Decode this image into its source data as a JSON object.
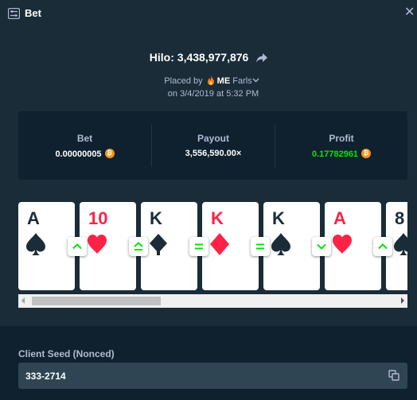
{
  "header": {
    "title": "Bet",
    "close_glyph": "✕"
  },
  "game": {
    "name": "Hilo",
    "bet_id": "3,438,977,876",
    "title_sep": ": "
  },
  "placed": {
    "prefix": "Placed by",
    "user_tag": "ME",
    "user_name": "Farls",
    "date_prefix": "on",
    "date": "3/4/2019",
    "at": "at",
    "time": "5:32 PM"
  },
  "stats": {
    "bet_label": "Bet",
    "bet_value": "0.00000005",
    "payout_label": "Payout",
    "payout_value": "3,556,590.00×",
    "profit_label": "Profit",
    "profit_value": "0.17782961"
  },
  "cards": [
    {
      "rank": "A",
      "suit": "spade",
      "color": "black"
    },
    {
      "rank": "10",
      "suit": "heart",
      "color": "red"
    },
    {
      "rank": "K",
      "suit": "club",
      "color": "black"
    },
    {
      "rank": "K",
      "suit": "diamond",
      "color": "red"
    },
    {
      "rank": "K",
      "suit": "spade",
      "color": "black"
    },
    {
      "rank": "A",
      "suit": "heart",
      "color": "red"
    },
    {
      "rank": "8",
      "suit": "spade",
      "color": "black"
    }
  ],
  "guesses": [
    "higher",
    "higher-or-same",
    "same",
    "same",
    "lower",
    "higher"
  ],
  "seed": {
    "label": "Client Seed (Nonced)",
    "value": "333-2714"
  },
  "colors": {
    "background": "#1a2c38",
    "panel": "#0f212e",
    "profit": "#00e701",
    "red_suit": "#fe2247",
    "guess_arrow": "#00e701",
    "coin": "#f7931a"
  },
  "icons": {
    "header": "bet-slip-icon",
    "share": "share-arrow-icon",
    "currency": "bitcoin-icon",
    "copy": "copy-icon",
    "flame": "flame-icon"
  }
}
